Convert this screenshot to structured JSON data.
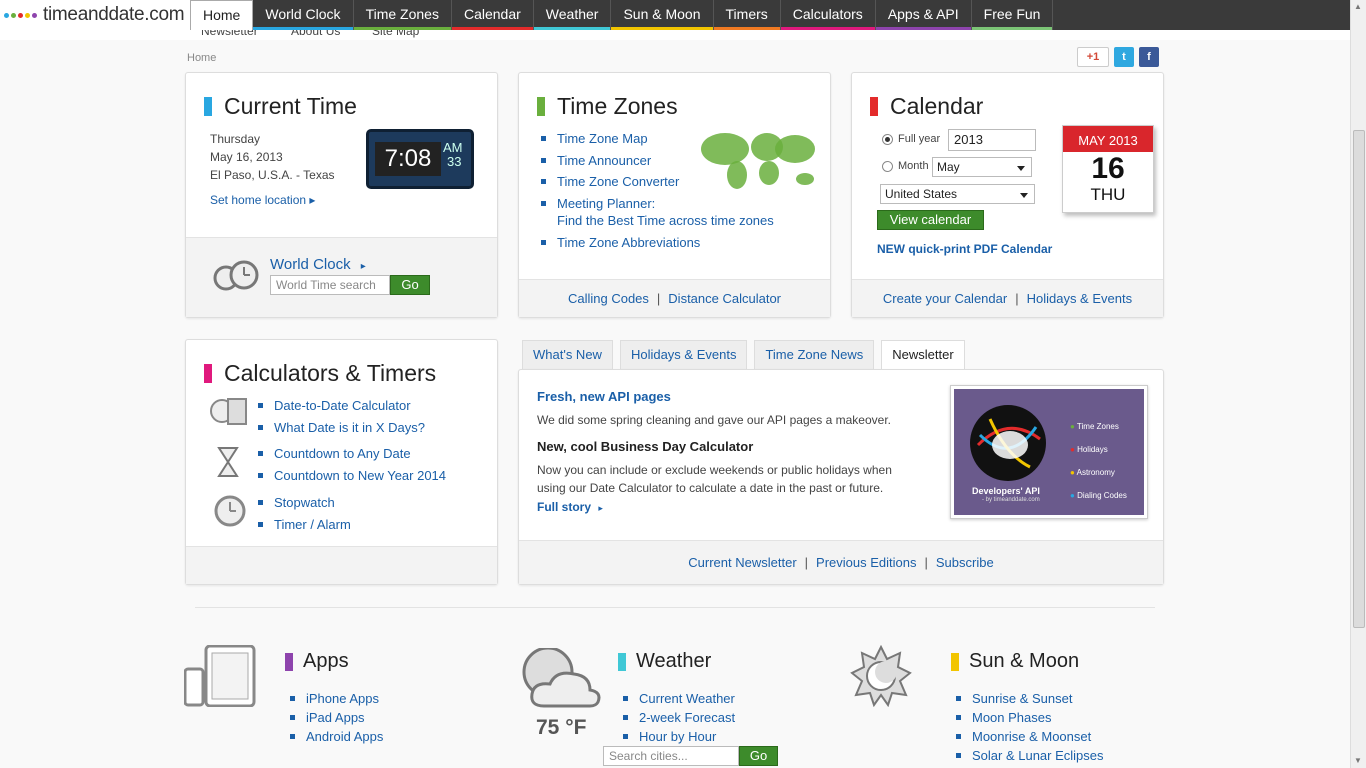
{
  "logo": {
    "text": "timeanddate.com"
  },
  "nav": [
    {
      "label": "Home",
      "color": "#ffffff"
    },
    {
      "label": "World Clock",
      "color": "#29a7e1"
    },
    {
      "label": "Time Zones",
      "color": "#6aaf3d"
    },
    {
      "label": "Calendar",
      "color": "#e32b2b"
    },
    {
      "label": "Weather",
      "color": "#40c8d6"
    },
    {
      "label": "Sun & Moon",
      "color": "#f2c500"
    },
    {
      "label": "Timers",
      "color": "#f07a22"
    },
    {
      "label": "Calculators",
      "color": "#e0197d"
    },
    {
      "label": "Apps & API",
      "color": "#8e44ad"
    },
    {
      "label": "Free Fun",
      "color": "#7cc576"
    }
  ],
  "subnav": [
    "Newsletter",
    "About Us",
    "Site Map"
  ],
  "breadcrumb": "Home",
  "social": {
    "gplus": "+1"
  },
  "current_time": {
    "title": "Current Time",
    "day": "Thursday",
    "date": "May 16, 2013",
    "location": "El Paso, U.S.A. - Texas",
    "set_home": "Set home location",
    "clock_time": "7:08",
    "clock_ampm": "AM",
    "clock_sec": "33",
    "world_clock_link": "World Clock",
    "search_placeholder": "World Time search",
    "go": "Go"
  },
  "time_zones": {
    "title": "Time Zones",
    "links": [
      "Time Zone Map",
      "Time Announcer",
      "Time Zone Converter",
      "Meeting Planner:",
      "Time Zone Abbreviations"
    ],
    "meeting_sub": "Find the Best Time across time zones",
    "footer": [
      "Calling Codes",
      "Distance Calculator"
    ]
  },
  "calendar": {
    "title": "Calendar",
    "full_year_label": "Full year",
    "year_value": "2013",
    "month_label": "Month",
    "month_value": "May",
    "country_value": "United States",
    "view_button": "View calendar",
    "pdf_link": "NEW quick-print PDF Calendar",
    "icon_month": "MAY",
    "icon_year": "2013",
    "icon_day": "16",
    "icon_weekday": "THU",
    "footer": [
      "Create your Calendar",
      "Holidays & Events"
    ]
  },
  "calculators": {
    "title": "Calculators & Timers",
    "group1": [
      "Date-to-Date Calculator",
      "What Date is it in X Days?"
    ],
    "group2": [
      "Countdown to Any Date",
      "Countdown to New Year 2014"
    ],
    "group3": [
      "Stopwatch",
      "Timer / Alarm"
    ]
  },
  "news": {
    "tabs": [
      "What's New",
      "Holidays & Events",
      "Time Zone News",
      "Newsletter"
    ],
    "active_tab": "Newsletter",
    "h1": "Fresh, new API pages",
    "p1": "We did some spring cleaning and gave our API pages a makeover.",
    "h2": "New, cool Business Day Calculator",
    "p2a": "Now you can include or exclude weekends or public holidays when",
    "p2b": "using our Date Calculator to calculate a date in the past or future.",
    "full_story": "Full story",
    "api_card": {
      "title": "Developers' API",
      "by": "- by timeanddate.com",
      "items": [
        "Time Zones",
        "Holidays",
        "Astronomy",
        "Dialing Codes"
      ]
    },
    "footer": [
      "Current Newsletter",
      "Previous Editions",
      "Subscribe"
    ]
  },
  "apps": {
    "title": "Apps",
    "links": [
      "iPhone Apps",
      "iPad Apps",
      "Android Apps"
    ]
  },
  "weather": {
    "title": "Weather",
    "temp": "75 °F",
    "links": [
      "Current Weather",
      "2-week Forecast",
      "Hour by Hour"
    ],
    "search_placeholder": "Search cities...",
    "go": "Go"
  },
  "sunmoon": {
    "title": "Sun & Moon",
    "links": [
      "Sunrise & Sunset",
      "Moon Phases",
      "Moonrise & Moonset",
      "Solar & Lunar Eclipses"
    ]
  }
}
